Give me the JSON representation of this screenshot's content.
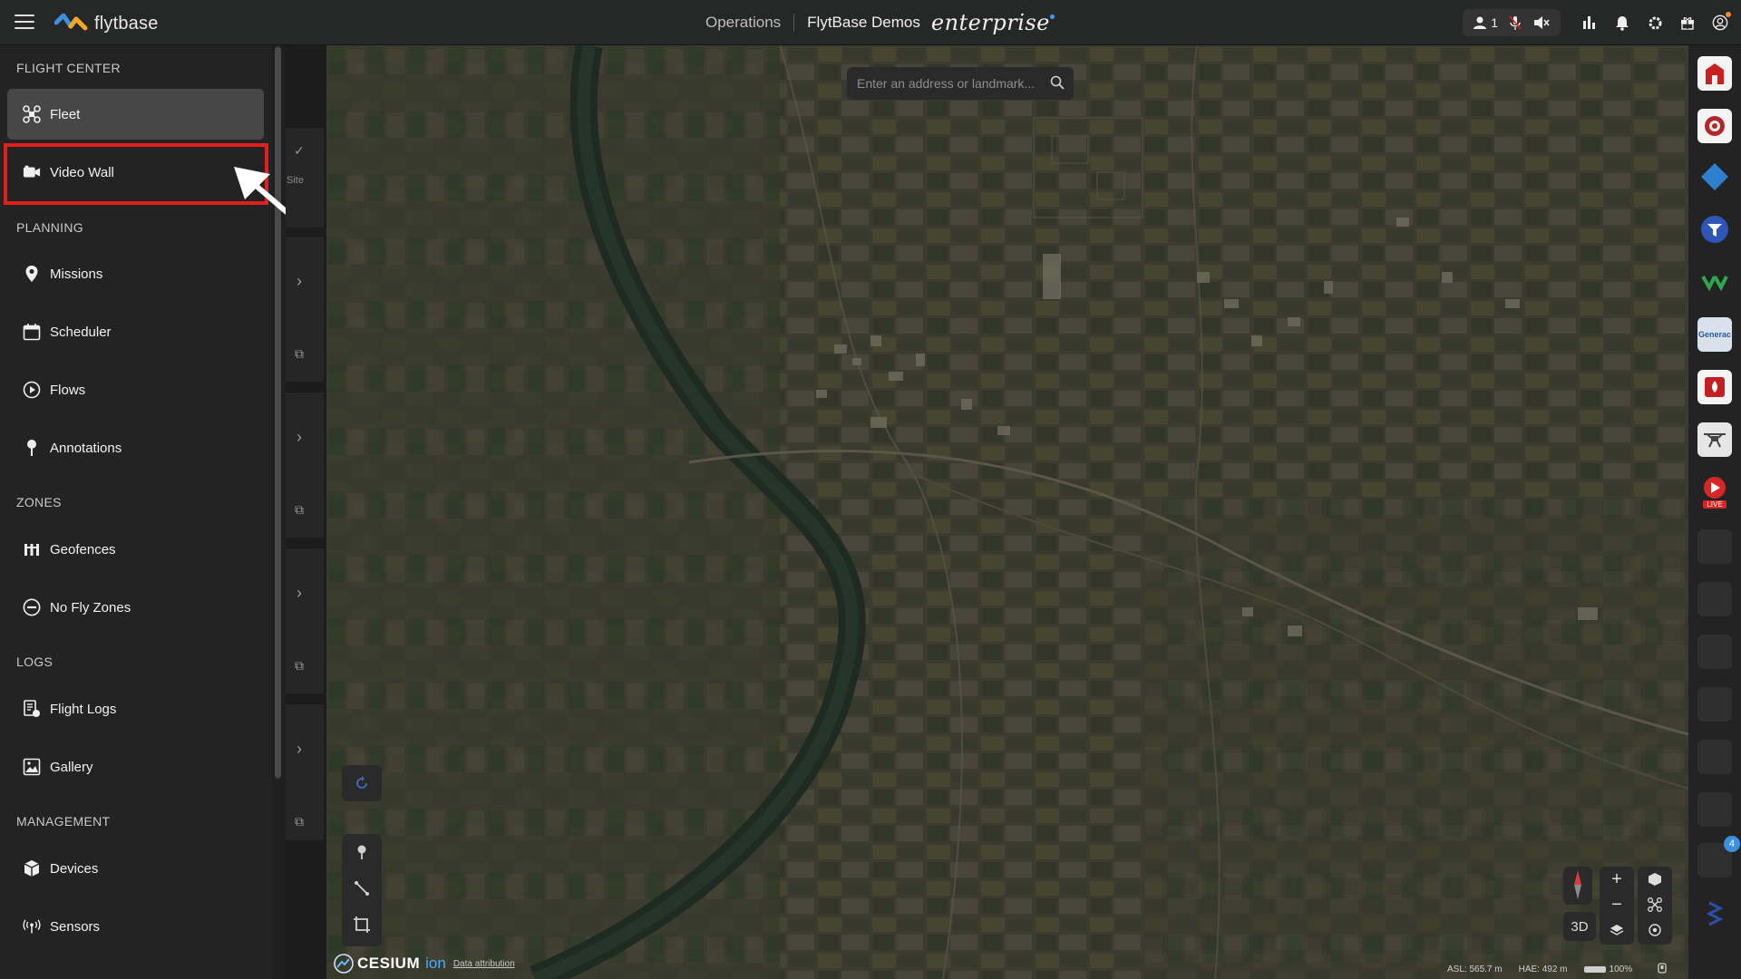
{
  "app": {
    "logo_text": "flytbase",
    "nav_tab": "Operations",
    "org_name": "FlytBase Demos",
    "tier": "enterprise",
    "user_count": "1"
  },
  "search": {
    "placeholder": "Enter an address or landmark..."
  },
  "sidebar": {
    "sections": [
      {
        "title": "FLIGHT CENTER"
      },
      {
        "title": "PLANNING"
      },
      {
        "title": "ZONES"
      },
      {
        "title": "LOGS"
      },
      {
        "title": "MANAGEMENT"
      }
    ],
    "items": [
      {
        "label": "Fleet",
        "icon": "drone-icon",
        "active": true
      },
      {
        "label": "Video Wall",
        "icon": "video-wall-icon"
      },
      {
        "label": "Missions",
        "icon": "location-pin-icon"
      },
      {
        "label": "Scheduler",
        "icon": "calendar-icon"
      },
      {
        "label": "Flows",
        "icon": "play-circle-icon"
      },
      {
        "label": "Annotations",
        "icon": "pin-icon"
      },
      {
        "label": "Geofences",
        "icon": "fence-icon"
      },
      {
        "label": "No Fly Zones",
        "icon": "no-entry-icon"
      },
      {
        "label": "Flight Logs",
        "icon": "log-icon"
      },
      {
        "label": "Gallery",
        "icon": "gallery-icon"
      },
      {
        "label": "Devices",
        "icon": "cube-icon"
      },
      {
        "label": "Sensors",
        "icon": "antenna-icon"
      }
    ]
  },
  "panel": {
    "site_label": "Site"
  },
  "map_controls": {
    "view_mode": "3D"
  },
  "footer": {
    "cesium": "CESIUM",
    "ion": "ion",
    "attribution": "Data attribution",
    "asl": "ASL: 565.7 m",
    "hae": "HAE: 492 m",
    "battery": "100%"
  },
  "right_rail": {
    "badge": "4",
    "live_label": "LIVE",
    "generac_label": "Generac"
  },
  "colors": {
    "accent": "#3d8fe0",
    "highlight": "#e0201f",
    "active_bg": "#474747",
    "sidebar_bg": "#232323"
  }
}
